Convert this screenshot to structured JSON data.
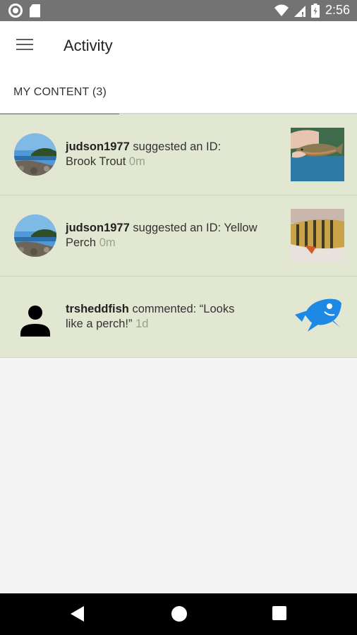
{
  "status_bar": {
    "time": "2:56",
    "battery_level": 0.7
  },
  "app_bar": {
    "title": "Activity"
  },
  "tabs": [
    {
      "label": "MY CONTENT (3)",
      "selected": true
    }
  ],
  "activity": [
    {
      "user": "judson1977",
      "action": "suggested an ID:",
      "detail": "Brook Trout",
      "time": "0m"
    },
    {
      "user": "judson1977",
      "action": "suggested an ID: Yellow",
      "detail": "Perch",
      "time": "0m"
    },
    {
      "user": "trsheddfish",
      "action": "commented: “Looks",
      "detail": "like a perch!”",
      "time": "1d"
    }
  ],
  "colors": {
    "row_bg": "#e2e7d2",
    "tab_indicator": "#2f80c0",
    "brand_blue": "#1e88e5",
    "status_bar": "#737373"
  }
}
